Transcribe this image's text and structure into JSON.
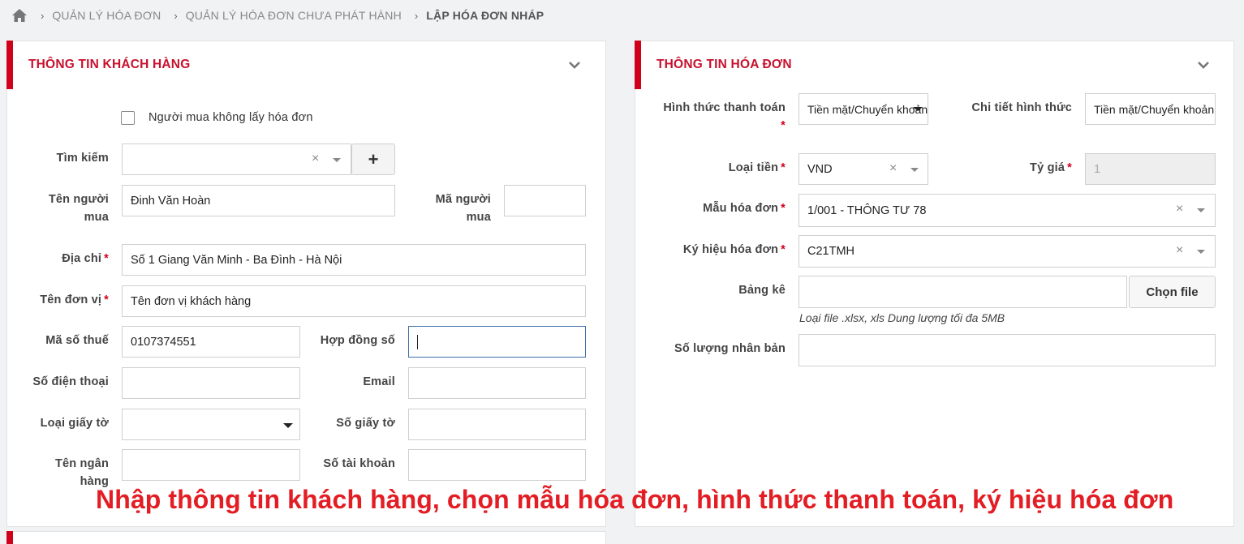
{
  "breadcrumb": {
    "items": [
      "QUẢN LÝ HÓA ĐƠN",
      "QUẢN LÝ HÓA ĐƠN CHƯA PHÁT HÀNH",
      "LẬP HÓA ĐƠN NHÁP"
    ],
    "icon": "home-icon"
  },
  "customer_panel": {
    "title": "THÔNG TIN KHÁCH HÀNG",
    "no_invoice_checkbox": {
      "label": "Người mua không lấy hóa đơn",
      "checked": false
    },
    "search": {
      "label": "Tìm kiếm",
      "value": "",
      "clear": "×",
      "add_button": "+"
    },
    "buyer_name": {
      "label_line1": "Tên người",
      "label_line2": "mua",
      "value": "Đinh Văn Hoàn"
    },
    "buyer_code": {
      "label_line1": "Mã người",
      "label_line2": "mua",
      "value": ""
    },
    "address": {
      "label": "Địa chỉ",
      "required": "*",
      "value": "Số 1 Giang Văn Minh - Ba Đình - Hà Nội"
    },
    "company_name": {
      "label": "Tên đơn vị",
      "required": "*",
      "value": "Tên đơn vị khách hàng"
    },
    "tax_code": {
      "label": "Mã số thuế",
      "value": "0107374551"
    },
    "contract_no": {
      "label": "Hợp đồng số",
      "value": ""
    },
    "phone": {
      "label": "Số điện thoại",
      "value": ""
    },
    "email": {
      "label": "Email",
      "value": ""
    },
    "doc_type": {
      "label": "Loại giấy tờ",
      "value": ""
    },
    "doc_no": {
      "label": "Số giấy tờ",
      "value": ""
    },
    "bank_name": {
      "label_line1": "Tên ngân",
      "label_line2": "hàng",
      "value": ""
    },
    "account_no": {
      "label": "Số tài khoản",
      "value": ""
    }
  },
  "invoice_panel": {
    "title": "THÔNG TIN HÓA ĐƠN",
    "payment_method": {
      "label": "Hình thức thanh toán",
      "required": "*",
      "value": "Tiền mặt/Chuyển khoản"
    },
    "payment_detail": {
      "label": "Chi tiết hình thức",
      "value": "Tiền mặt/Chuyển khoản"
    },
    "currency": {
      "label": "Loại tiền",
      "required": "*",
      "value": "VND",
      "clear": "×"
    },
    "exchange_rate": {
      "label": "Tỷ giá",
      "required": "*",
      "value": "1"
    },
    "template": {
      "label": "Mẫu hóa đơn",
      "required": "*",
      "value": "1/001 - THÔNG TƯ 78",
      "clear": "×"
    },
    "symbol": {
      "label": "Ký hiệu hóa đơn",
      "required": "*",
      "value": "C21TMH",
      "clear": "×"
    },
    "statement": {
      "label": "Bảng kê",
      "value": "",
      "button": "Chọn file",
      "note": "Loại file .xlsx, xls Dung lượng tối đa 5MB"
    },
    "copies": {
      "label": "Số lượng nhân bản",
      "value": ""
    }
  },
  "overlay_caption": "Nhập thông tin khách hàng, chọn mẫu hóa đơn, hình thức thanh toán, ký hiệu hóa đơn",
  "colors": {
    "accent": "#d0021b",
    "title": "#c8102e",
    "caption": "#e31d24"
  }
}
